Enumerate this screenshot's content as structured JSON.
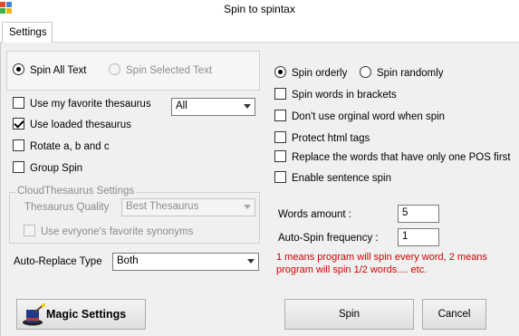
{
  "window": {
    "title": "Spin to spintax"
  },
  "tabs": [
    {
      "label": "Settings"
    }
  ],
  "left": {
    "spin_mode": [
      {
        "label": "Spin All Text",
        "checked": true,
        "enabled": true
      },
      {
        "label": "Spin Selected Text",
        "checked": false,
        "enabled": false
      }
    ],
    "checkboxes": [
      {
        "label": "Use my favorite thesaurus",
        "checked": false
      },
      {
        "label": "Use loaded thesaurus",
        "checked": true
      },
      {
        "label": "Rotate a, b and c",
        "checked": false
      },
      {
        "label": "Group Spin",
        "checked": false
      }
    ],
    "thesaurus_filter": {
      "value": "All"
    },
    "cloud": {
      "legend": "CloudThesaurus Settings",
      "quality_label": "Thesaurus Quality",
      "quality_value": "Best Thesaurus",
      "favorite_label": "Use evryone's favorite synonyms"
    },
    "auto_replace": {
      "label": "Auto-Replace Type",
      "value": "Both"
    },
    "magic_button": "Magic Settings"
  },
  "right": {
    "spin_order": [
      {
        "label": "Spin orderly",
        "checked": true
      },
      {
        "label": "Spin randomly",
        "checked": false
      }
    ],
    "checkboxes": [
      {
        "label": "Spin words in brackets",
        "checked": false
      },
      {
        "label": "Don't use orginal word when spin",
        "checked": false
      },
      {
        "label": "Protect html tags",
        "checked": false
      },
      {
        "label": "Replace the words that have only one POS first",
        "checked": false
      },
      {
        "label": "Enable sentence spin",
        "checked": false
      }
    ],
    "words_amount": {
      "label": "Words amount :",
      "value": "5"
    },
    "auto_spin": {
      "label": "Auto-Spin frequency :",
      "value": "1"
    },
    "note": "1 means program will spin every word, 2 means program will spin 1/2 words.... etc.",
    "spin_button": "Spin",
    "cancel_button": "Cancel"
  },
  "colors": {
    "note": "#d00000",
    "panel": "#f0f0f0"
  }
}
